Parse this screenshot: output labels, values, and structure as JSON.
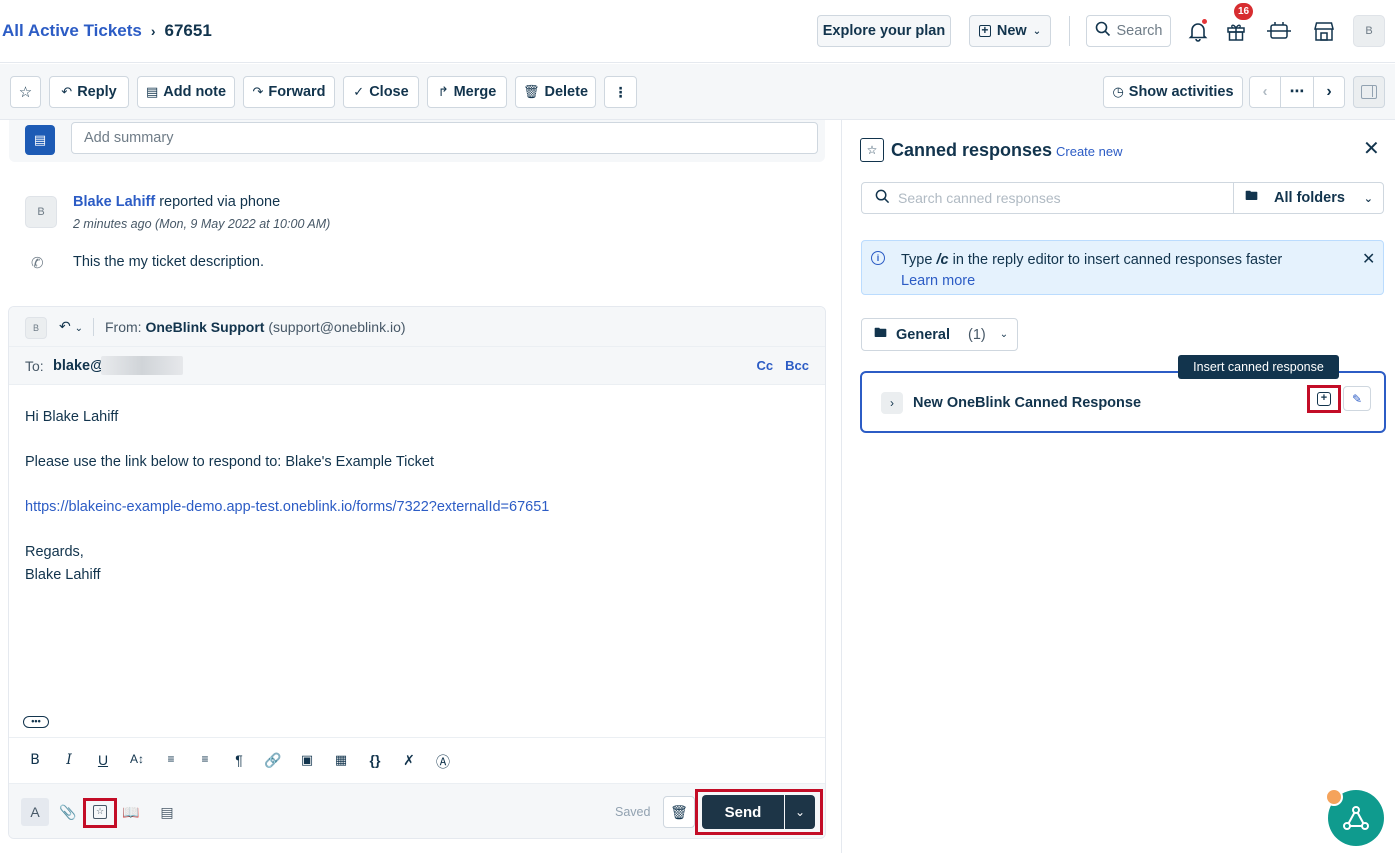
{
  "header": {
    "breadcrumb_root": "All Active Tickets",
    "breadcrumb_current": "67651",
    "explore_plan": "Explore your plan",
    "new_label": "New",
    "search_label": "Search",
    "notif_count": "16",
    "avatar_initial": "B"
  },
  "actions": {
    "reply": "Reply",
    "add_note": "Add note",
    "forward": "Forward",
    "close": "Close",
    "merge": "Merge",
    "delete": "Delete",
    "show_activities": "Show activities"
  },
  "summary": {
    "placeholder": "Add summary"
  },
  "ticket": {
    "requester_initial": "B",
    "requester_name": "Blake Lahiff",
    "reported_via": "reported via phone",
    "time": "2 minutes ago (Mon, 9 May 2022 at 10:00 AM)",
    "description": "This the my ticket description."
  },
  "reply": {
    "avatar_initial": "B",
    "from_label": "From:",
    "from_name": "OneBlink Support",
    "from_email": "(support@oneblink.io)",
    "to_label": "To:",
    "to_value": "blake@",
    "cc": "Cc",
    "bcc": "Bcc",
    "body_greeting": "Hi Blake Lahiff",
    "body_line": "Please use the link below to respond to: Blake's Example Ticket",
    "body_link": "https://blakeinc-example-demo.app-test.oneblink.io/forms/7322?externalId=67651",
    "body_regards": "Regards,",
    "body_signature": "Blake Lahiff",
    "more": "•••",
    "saved": "Saved",
    "send": "Send"
  },
  "canned": {
    "title": "Canned responses",
    "create_new": "Create new",
    "search_placeholder": "Search canned responses",
    "all_folders": "All folders",
    "info_prefix": "Type ",
    "info_cmd": "/c",
    "info_suffix": " in the reply editor to insert canned responses faster",
    "learn_more": "Learn more",
    "folder_name": "General",
    "folder_count": "(1)",
    "response_title": "New OneBlink Canned Response",
    "tooltip": "Insert canned response"
  },
  "colors": {
    "link": "#2c5cc5",
    "text": "#12344d",
    "highlight": "#c30d27",
    "send": "#1d3547"
  }
}
